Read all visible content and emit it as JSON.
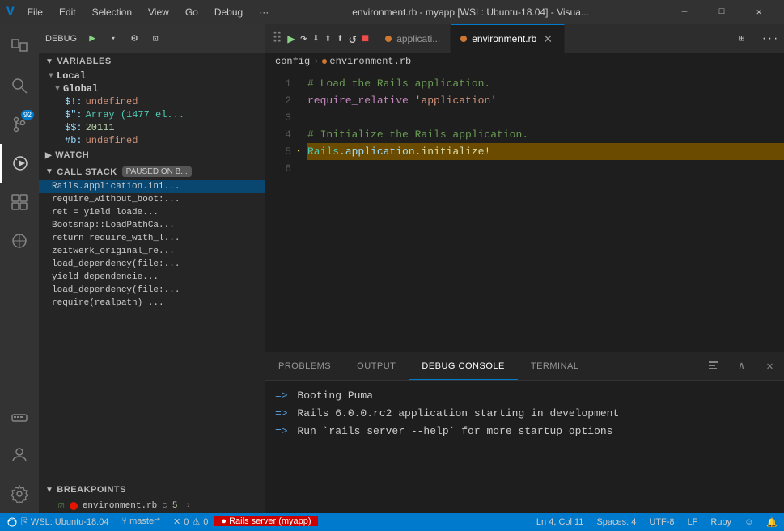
{
  "titleBar": {
    "icon": "V",
    "menuItems": [
      "File",
      "Edit",
      "Selection",
      "View",
      "Go",
      "Debug",
      "···"
    ],
    "title": "environment.rb - myapp [WSL: Ubuntu-18.04] - Visua...",
    "windowControls": [
      "—",
      "□",
      "✕"
    ]
  },
  "activityBar": {
    "icons": [
      {
        "name": "explorer-icon",
        "symbol": "⎘",
        "active": false
      },
      {
        "name": "search-icon",
        "symbol": "🔍",
        "active": false
      },
      {
        "name": "scm-icon",
        "symbol": "⑂",
        "active": false,
        "badge": "92"
      },
      {
        "name": "debug-icon",
        "symbol": "🐛",
        "active": true
      },
      {
        "name": "extensions-icon",
        "symbol": "⬡",
        "active": false
      },
      {
        "name": "remote-icon",
        "symbol": "⊘",
        "active": false
      },
      {
        "name": "docker-icon",
        "symbol": "🐋",
        "active": false
      }
    ],
    "bottomIcons": [
      {
        "name": "accounts-icon",
        "symbol": "👤"
      },
      {
        "name": "settings-icon",
        "symbol": "⚙"
      }
    ]
  },
  "debugToolbar": {
    "label": "DEBUG",
    "buttons": [
      {
        "name": "continue-btn",
        "symbol": "▶",
        "class": "play"
      },
      {
        "name": "debug-dropdown",
        "symbol": "▾"
      },
      {
        "name": "debug-settings",
        "symbol": "⚙"
      },
      {
        "name": "debug-terminal",
        "symbol": "⊡"
      }
    ],
    "playButtons": [
      {
        "name": "step-over-btn",
        "symbol": "↷"
      },
      {
        "name": "step-into-btn",
        "symbol": "⤵"
      },
      {
        "name": "step-out-btn",
        "symbol": "⤴"
      },
      {
        "name": "step-back-btn",
        "symbol": "↑"
      },
      {
        "name": "restart-btn",
        "symbol": "↺"
      },
      {
        "name": "stop-btn",
        "symbol": "■"
      }
    ]
  },
  "sidebar": {
    "variables": {
      "header": "VARIABLES",
      "local": {
        "label": "Local",
        "items": []
      },
      "global": {
        "label": "Global",
        "items": [
          {
            "name": "$!:",
            "value": "undefined"
          },
          {
            "name": "$\":",
            "value": "Array (1477 el..."
          },
          {
            "name": "$$:",
            "value": "20111"
          },
          {
            "name": "#b:",
            "value": "undefined"
          }
        ]
      }
    },
    "watch": {
      "header": "WATCH"
    },
    "callstack": {
      "header": "CALL STACK",
      "badge": "PAUSED ON B...",
      "items": [
        "Rails.application.ini...",
        "require_without_boot:...",
        "ret = yield loade...",
        "Bootsnap::LoadPathCa...",
        "return require_with_l...",
        "zeitwerk_original_re...",
        "load_dependency(file:...",
        "yield dependencie...",
        "load_dependency(file:...",
        "require(realpath) ..."
      ]
    },
    "breakpoints": {
      "header": "BREAKPOINTS",
      "items": [
        {
          "file": "environment.rb",
          "char": "c",
          "num": "5"
        }
      ]
    }
  },
  "editor": {
    "tabs": [
      {
        "name": "applicatio...",
        "icon": "ruby-file",
        "active": false,
        "dot": true
      },
      {
        "name": "environment.rb",
        "icon": "ruby-file",
        "active": true,
        "closable": true
      }
    ],
    "breadcrumb": {
      "path": "config",
      "separator": "›",
      "file": "environment.rb"
    },
    "lines": [
      {
        "num": 1,
        "tokens": [
          {
            "text": "#·Load·the·Rails·application.",
            "class": "c-comment"
          }
        ]
      },
      {
        "num": 2,
        "tokens": [
          {
            "text": "require_relative",
            "class": "c-keyword"
          },
          {
            "text": " ",
            "class": ""
          },
          {
            "text": "'application'",
            "class": "c-string"
          }
        ]
      },
      {
        "num": 3,
        "tokens": []
      },
      {
        "num": 4,
        "tokens": [
          {
            "text": "#·Initialize·the·Rails·application.",
            "class": "c-comment"
          }
        ]
      },
      {
        "num": 5,
        "tokens": [
          {
            "text": "Rails",
            "class": "c-class"
          },
          {
            "text": ".",
            "class": "c-punct"
          },
          {
            "text": "application",
            "class": "c-const"
          },
          {
            "text": ".",
            "class": "c-punct"
          },
          {
            "text": "initialize!",
            "class": "c-method"
          }
        ],
        "debug": true
      },
      {
        "num": 6,
        "tokens": []
      }
    ]
  },
  "bottomPanel": {
    "tabs": [
      {
        "label": "PROBLEMS",
        "active": false
      },
      {
        "label": "OUTPUT",
        "active": false
      },
      {
        "label": "DEBUG CONSOLE",
        "active": true
      },
      {
        "label": "TERMINAL",
        "active": false
      }
    ],
    "console": [
      "=> Booting Puma",
      "=> Rails 6.0.0.rc2 application starting in development",
      "=> Run `rails server --help` for more startup options"
    ]
  },
  "statusBar": {
    "left": [
      {
        "text": "⎘ WSL: Ubuntu-18.04",
        "type": "remote"
      },
      {
        "text": "⑂ master*",
        "type": "branch"
      }
    ],
    "errors": {
      "icon": "✕",
      "count": "0"
    },
    "warnings": {
      "icon": "⚠",
      "count": "0"
    },
    "right": [
      {
        "text": "● Rails server (myapp)",
        "type": "debug"
      },
      {
        "text": "Ln 4, Col 11"
      },
      {
        "text": "Spaces: 4"
      },
      {
        "text": "UTF-8"
      },
      {
        "text": "LF"
      },
      {
        "text": "Ruby"
      },
      {
        "text": "☺"
      },
      {
        "text": "🔔"
      }
    ]
  }
}
